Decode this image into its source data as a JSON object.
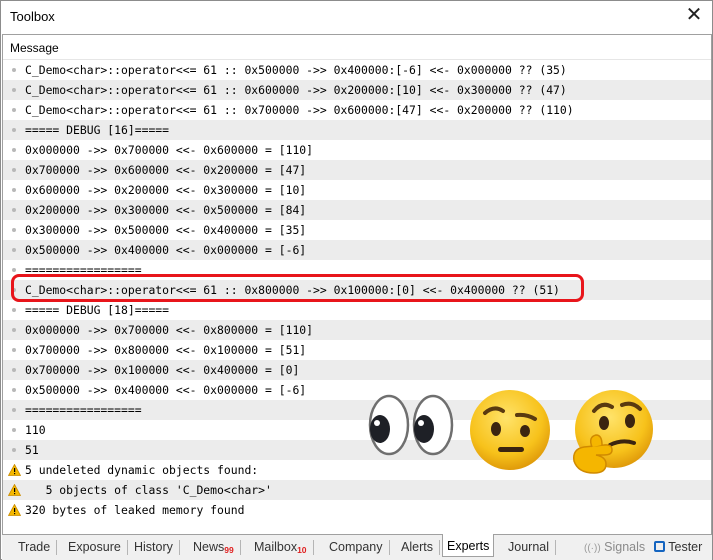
{
  "window": {
    "title": "Toolbox"
  },
  "columns": {
    "message": "Message"
  },
  "rows": [
    {
      "icon": "bullet",
      "text": "C_Demo<char>::operator<<= 61 :: 0x500000 ->> 0x400000:[-6] <<- 0x000000 ?? (35)"
    },
    {
      "icon": "bullet",
      "text": "C_Demo<char>::operator<<= 61 :: 0x600000 ->> 0x200000:[10] <<- 0x300000 ?? (47)"
    },
    {
      "icon": "bullet",
      "text": "C_Demo<char>::operator<<= 61 :: 0x700000 ->> 0x600000:[47] <<- 0x200000 ?? (110)"
    },
    {
      "icon": "bullet",
      "text": "===== DEBUG [16]====="
    },
    {
      "icon": "bullet",
      "text": "0x000000 ->> 0x700000 <<- 0x600000 = [110]"
    },
    {
      "icon": "bullet",
      "text": "0x700000 ->> 0x600000 <<- 0x200000 = [47]"
    },
    {
      "icon": "bullet",
      "text": "0x600000 ->> 0x200000 <<- 0x300000 = [10]"
    },
    {
      "icon": "bullet",
      "text": "0x200000 ->> 0x300000 <<- 0x500000 = [84]"
    },
    {
      "icon": "bullet",
      "text": "0x300000 ->> 0x500000 <<- 0x400000 = [35]"
    },
    {
      "icon": "bullet",
      "text": "0x500000 ->> 0x400000 <<- 0x000000 = [-6]"
    },
    {
      "icon": "bullet",
      "text": "================="
    },
    {
      "icon": "bullet",
      "text": "C_Demo<char>::operator<<= 61 :: 0x800000 ->> 0x100000:[0] <<- 0x400000 ?? (51)"
    },
    {
      "icon": "bullet",
      "text": "===== DEBUG [18]====="
    },
    {
      "icon": "bullet",
      "text": "0x000000 ->> 0x700000 <<- 0x800000 = [110]"
    },
    {
      "icon": "bullet",
      "text": "0x700000 ->> 0x800000 <<- 0x100000 = [51]"
    },
    {
      "icon": "bullet",
      "text": "0x700000 ->> 0x100000 <<- 0x400000 = [0]"
    },
    {
      "icon": "bullet",
      "text": "0x500000 ->> 0x400000 <<- 0x000000 = [-6]"
    },
    {
      "icon": "bullet",
      "text": "================="
    },
    {
      "icon": "bullet",
      "text": "110"
    },
    {
      "icon": "bullet",
      "text": "51"
    },
    {
      "icon": "warning",
      "text": "5 undeleted dynamic objects found:"
    },
    {
      "icon": "warning",
      "text": "   5 objects of class 'C_Demo<char>'"
    },
    {
      "icon": "warning",
      "text": "320 bytes of leaked memory found"
    }
  ],
  "tabs": [
    {
      "label": "Trade",
      "badge": ""
    },
    {
      "label": "Exposure",
      "badge": ""
    },
    {
      "label": "History",
      "badge": ""
    },
    {
      "label": "News",
      "badge": "99"
    },
    {
      "label": "Mailbox",
      "badge": "10"
    },
    {
      "label": "Company",
      "badge": ""
    },
    {
      "label": "Alerts",
      "badge": ""
    },
    {
      "label": "Experts",
      "badge": ""
    },
    {
      "label": "Journal",
      "badge": ""
    }
  ],
  "right_tabs": {
    "signals": "Signals",
    "tester": "Tester"
  },
  "colors": {
    "highlight": "#e8151b",
    "badge": "#e02020",
    "warning": "#f5b800",
    "alt_row": "#ececec"
  },
  "emojis": [
    "eyes-icon",
    "raised-eyebrow-face-icon",
    "thinking-face-icon"
  ]
}
